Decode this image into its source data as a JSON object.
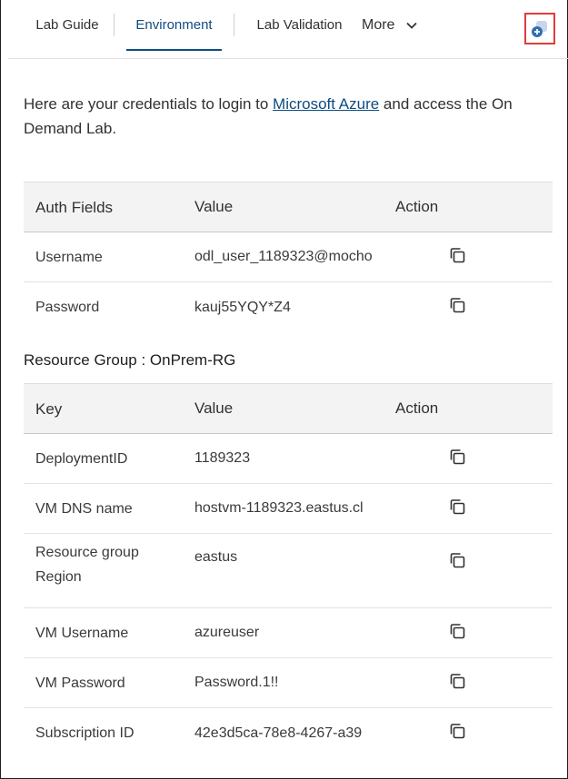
{
  "tabs": {
    "lab_guide": "Lab Guide",
    "environment": "Environment",
    "lab_validation": "Lab Validation",
    "more": "More"
  },
  "intro": {
    "prefix": "Here are your credentials to login to ",
    "link": "Microsoft Azure",
    "suffix": " and access the On Demand Lab."
  },
  "auth_table": {
    "headers": [
      "Auth Fields",
      "Value",
      "Action"
    ],
    "rows": [
      {
        "field": "Username",
        "value": "odl_user_1189323@mocho"
      },
      {
        "field": "Password",
        "value": "kauj55YQY*Z4"
      }
    ]
  },
  "resource_group": {
    "title": "Resource Group : OnPrem-RG",
    "headers": [
      "Key",
      "Value",
      "Action"
    ],
    "rows": [
      {
        "key": "DeploymentID",
        "value": "1189323"
      },
      {
        "key": "VM DNS name",
        "value": "hostvm-1189323.eastus.cl"
      },
      {
        "key": "Resource group Region",
        "value": "eastus"
      },
      {
        "key": "VM Username",
        "value": "azureuser"
      },
      {
        "key": "VM Password",
        "value": "Password.1!!"
      },
      {
        "key": "Subscription ID",
        "value": "42e3d5ca-78e8-4267-a39"
      }
    ]
  },
  "icons": {
    "copy": "copy-icon",
    "chevron": "chevron-down-icon",
    "corner": "add-window-icon"
  },
  "colors": {
    "accent": "#0f4c81",
    "highlight_border": "#e23b3b",
    "header_bg": "#f3f3f3"
  }
}
